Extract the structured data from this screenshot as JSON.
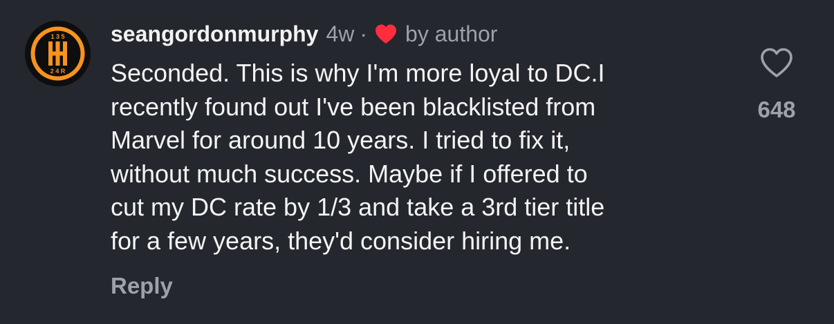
{
  "comment": {
    "avatar_icon": "gear-shifter-logo-icon",
    "avatar_logo_text": {
      "top": "1 3 5",
      "bottom": "2 4 R"
    },
    "username": "seangordonmurphy",
    "time_ago": "4w",
    "separator": "·",
    "author_heart_icon": "red-heart-icon",
    "author_label": "by author",
    "text_lines": [
      "Seconded. This is why I'm more loyal to DC.I",
      "recently found out I've been blacklisted from",
      "Marvel for around 10 years. I tried to fix it,",
      "without much success. Maybe if I offered to",
      "cut my DC rate by 1/3 and take a 3rd tier title",
      "for a few years, they'd consider hiring me."
    ],
    "reply_label": "Reply",
    "like_icon": "heart-outline-icon",
    "like_count": "648"
  },
  "colors": {
    "background": "#25272e",
    "text_primary": "#f4f4f4",
    "text_secondary": "#9ea1a8",
    "author_heart": "#ff2d3d",
    "avatar_orange": "#f7931e"
  }
}
